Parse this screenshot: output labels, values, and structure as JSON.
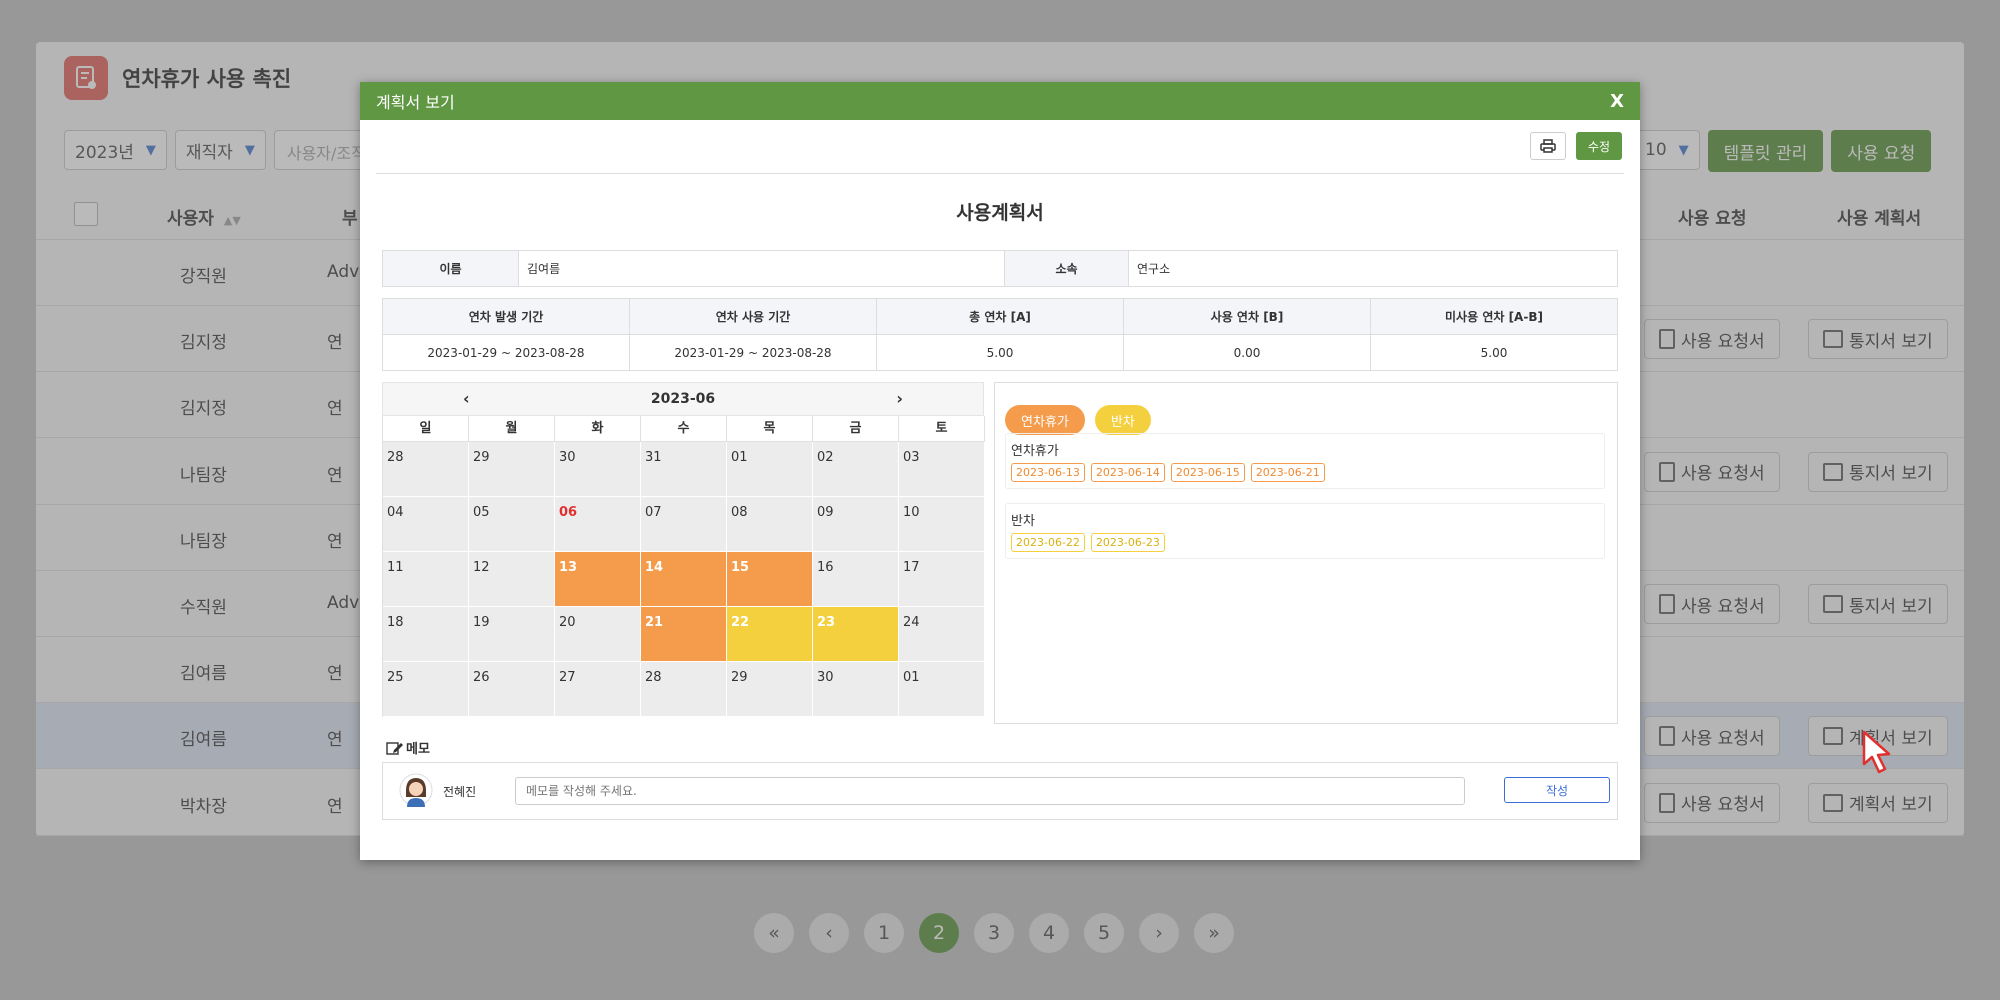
{
  "app": {
    "title": "연차휴가 사용 촉진"
  },
  "filters": {
    "year": "2023년",
    "status": "재직자",
    "search_placeholder": "사용자/조직",
    "page_size": "10"
  },
  "toolbar": {
    "template_label": "템플릿 관리",
    "request_label": "사용 요청"
  },
  "table": {
    "headers": {
      "user": "사용자",
      "dept": "부",
      "use_request": "사용 요청",
      "use_plan": "사용 계획서"
    },
    "rows": [
      {
        "user": "강직원",
        "dept": "Adva",
        "req": "",
        "plan": ""
      },
      {
        "user": "김지정",
        "dept": "연",
        "req": "사용 요청서",
        "plan": "통지서 보기"
      },
      {
        "user": "김지정",
        "dept": "연",
        "req": "",
        "plan": ""
      },
      {
        "user": "나팀장",
        "dept": "연",
        "req": "사용 요청서",
        "plan": "통지서 보기"
      },
      {
        "user": "나팀장",
        "dept": "연",
        "req": "",
        "plan": ""
      },
      {
        "user": "수직원",
        "dept": "Adva",
        "req": "사용 요청서",
        "plan": "통지서 보기"
      },
      {
        "user": "김여름",
        "dept": "연",
        "req": "",
        "plan": ""
      },
      {
        "user": "김여름",
        "dept": "연",
        "req": "사용 요청서",
        "plan": "계획서 보기"
      },
      {
        "user": "박차장",
        "dept": "연",
        "req": "사용 요청서",
        "plan": "계획서 보기"
      }
    ]
  },
  "pagination": {
    "first": "«",
    "prev": "‹",
    "pages": [
      "1",
      "2",
      "3",
      "4",
      "5"
    ],
    "current": "2",
    "next": "›",
    "last": "»"
  },
  "modal": {
    "title": "계획서 보기",
    "close": "X",
    "edit_label": "수정",
    "doc_title": "사용계획서",
    "info": {
      "name_label": "이름",
      "name": "김여름",
      "dept_label": "소속",
      "dept": "연구소"
    },
    "stats": {
      "headers": [
        "연차 발생 기간",
        "연차 사용 기간",
        "총 연차 [A]",
        "사용 연차 [B]",
        "미사용 연차 [A-B]"
      ],
      "values": [
        "2023-01-29 ~ 2023-08-28",
        "2023-01-29 ~ 2023-08-28",
        "5.00",
        "0.00",
        "5.00"
      ]
    },
    "calendar": {
      "month": "2023-06",
      "prev": "‹",
      "next": "›",
      "weekdays": [
        "일",
        "월",
        "화",
        "수",
        "목",
        "금",
        "토"
      ],
      "days": [
        [
          "28",
          "29",
          "30",
          "31",
          "01",
          "02",
          "03"
        ],
        [
          "04",
          "05",
          "06",
          "07",
          "08",
          "09",
          "10"
        ],
        [
          "11",
          "12",
          "13",
          "14",
          "15",
          "16",
          "17"
        ],
        [
          "18",
          "19",
          "20",
          "21",
          "22",
          "23",
          "24"
        ],
        [
          "25",
          "26",
          "27",
          "28",
          "29",
          "30",
          "01"
        ]
      ],
      "holiday": "06",
      "annual_days": [
        "13",
        "14",
        "15",
        "21"
      ],
      "half_days": [
        "22",
        "23"
      ],
      "colors": {
        "annual": "#f59b4c",
        "half": "#f4d03f",
        "holiday": "#e03030"
      }
    },
    "legend": {
      "annual": "연차휴가",
      "half": "반차"
    },
    "groups": [
      {
        "title": "연차휴가",
        "dates": [
          "2023-06-13",
          "2023-06-14",
          "2023-06-15",
          "2023-06-21"
        ]
      },
      {
        "title": "반차",
        "dates": [
          "2023-06-22",
          "2023-06-23"
        ]
      }
    ],
    "memo": {
      "label": "메모",
      "user": "전혜진",
      "placeholder": "메모를 작성해 주세요.",
      "submit": "작성"
    }
  },
  "colors": {
    "primary": "#5f9742",
    "annual": "#f59b4c",
    "half": "#f4d03f",
    "link": "#3c6ed8"
  }
}
